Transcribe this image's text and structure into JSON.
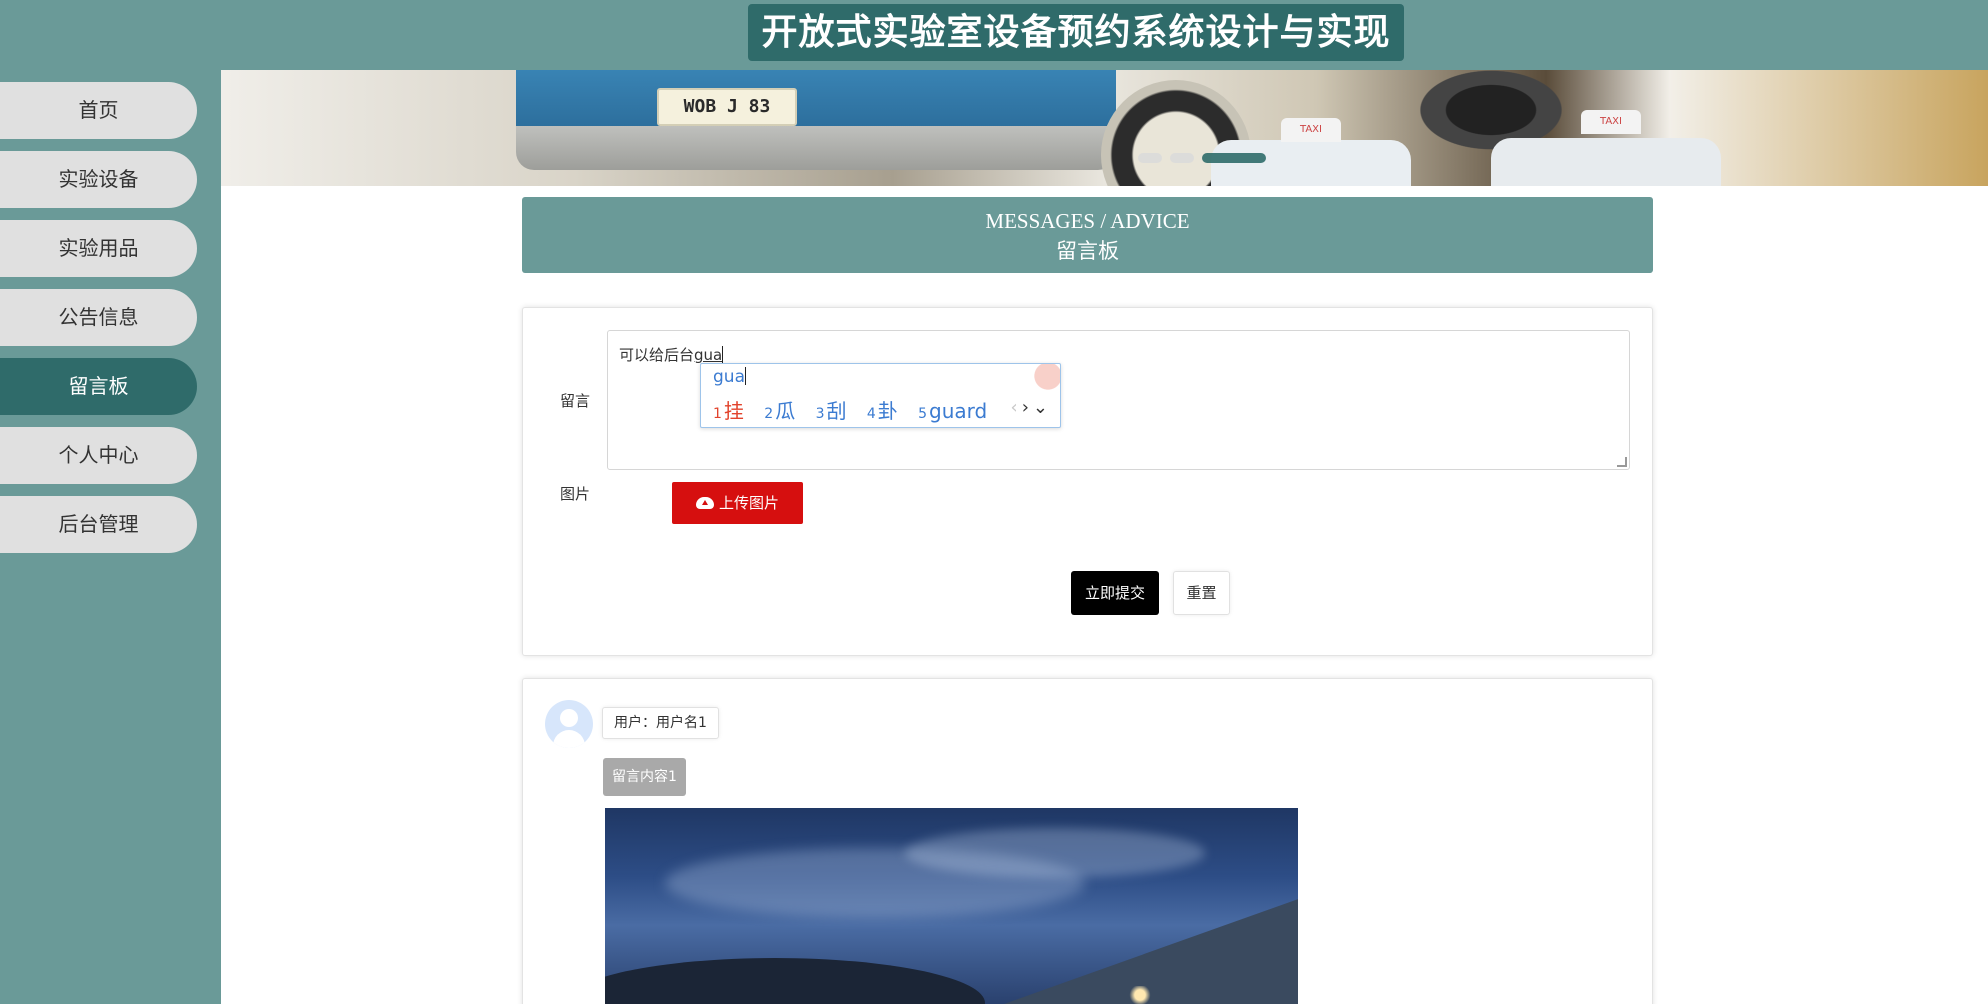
{
  "header": {
    "title": "开放式实验室设备预约系统设计与实现"
  },
  "nav": {
    "items": [
      {
        "label": "首页"
      },
      {
        "label": "实验设备"
      },
      {
        "label": "实验用品"
      },
      {
        "label": "公告信息"
      },
      {
        "label": "留言板",
        "active": true
      },
      {
        "label": "个人中心"
      },
      {
        "label": "后台管理"
      }
    ]
  },
  "banner": {
    "plate_text": "WOB J 83",
    "taxi_sign": "TAXI",
    "slides_total": 3,
    "active_slide": 3
  },
  "section": {
    "title_en": "MESSAGES / ADVICE",
    "title_cn": "留言板"
  },
  "form": {
    "message_label": "留言",
    "message_value_prefix": "可以给后台",
    "message_value_composing": "gua",
    "image_label": "图片",
    "upload_label": "上传图片",
    "submit_label": "立即提交",
    "reset_label": "重置"
  },
  "ime": {
    "pinyin": "gua",
    "candidates": [
      {
        "n": "1",
        "text": "挂"
      },
      {
        "n": "2",
        "text": "瓜"
      },
      {
        "n": "3",
        "text": "刮"
      },
      {
        "n": "4",
        "text": "卦"
      },
      {
        "n": "5",
        "text": "guard"
      }
    ],
    "prev_glyph": "‹",
    "next_glyph": "›",
    "expand_glyph": "⌄"
  },
  "messages": [
    {
      "user": "用户：用户名1",
      "content": "留言内容1"
    }
  ],
  "colors": {
    "theme": "#6a9a98",
    "theme_dark": "#2f6b6a",
    "upload_red": "#d60f0f",
    "submit_black": "#000000"
  }
}
